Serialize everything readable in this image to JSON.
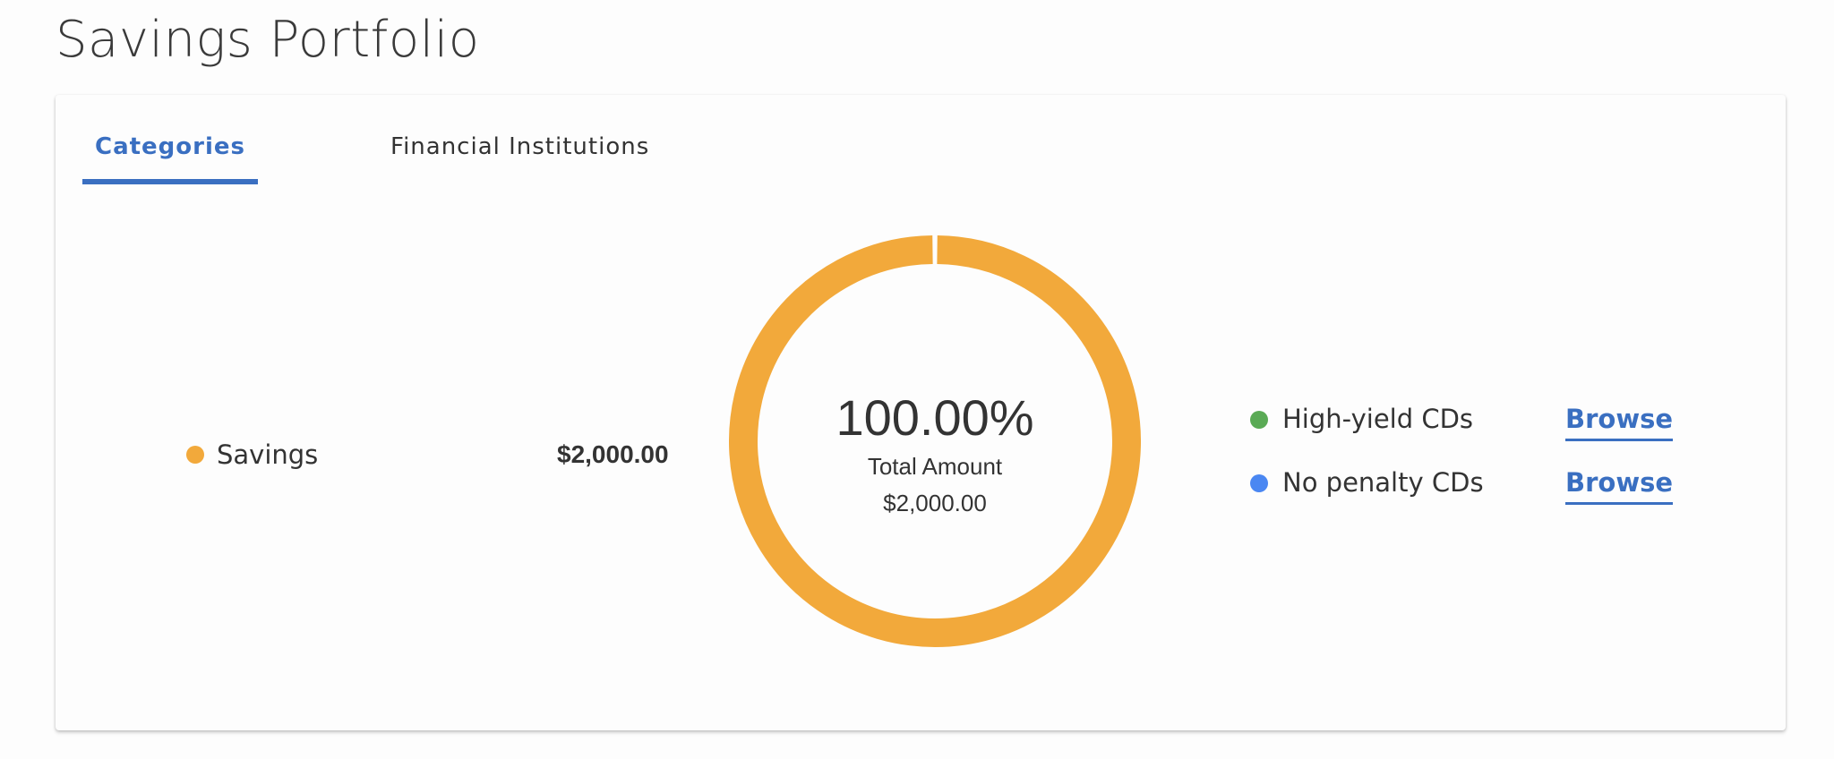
{
  "page": {
    "title": "Savings Portfolio"
  },
  "tabs": [
    {
      "label": "Categories",
      "active": true
    },
    {
      "label": "Financial Institutions",
      "active": false
    }
  ],
  "legend": {
    "items": [
      {
        "label": "Savings",
        "amount": "$2,000.00",
        "color": "#f2a93b"
      }
    ]
  },
  "donut": {
    "percent": "100.00%",
    "label": "Total Amount",
    "total": "$2,000.00"
  },
  "options": [
    {
      "label": "High-yield CDs",
      "color": "#5aaa55",
      "action": "Browse"
    },
    {
      "label": "No penalty CDs",
      "color": "#4a87f2",
      "action": "Browse"
    }
  ],
  "chart_data": {
    "type": "pie",
    "categories": [
      "Savings"
    ],
    "values": [
      2000
    ],
    "colors": [
      "#f2a93b"
    ],
    "center_text": [
      "100.00%",
      "Total Amount",
      "$2,000.00"
    ]
  }
}
